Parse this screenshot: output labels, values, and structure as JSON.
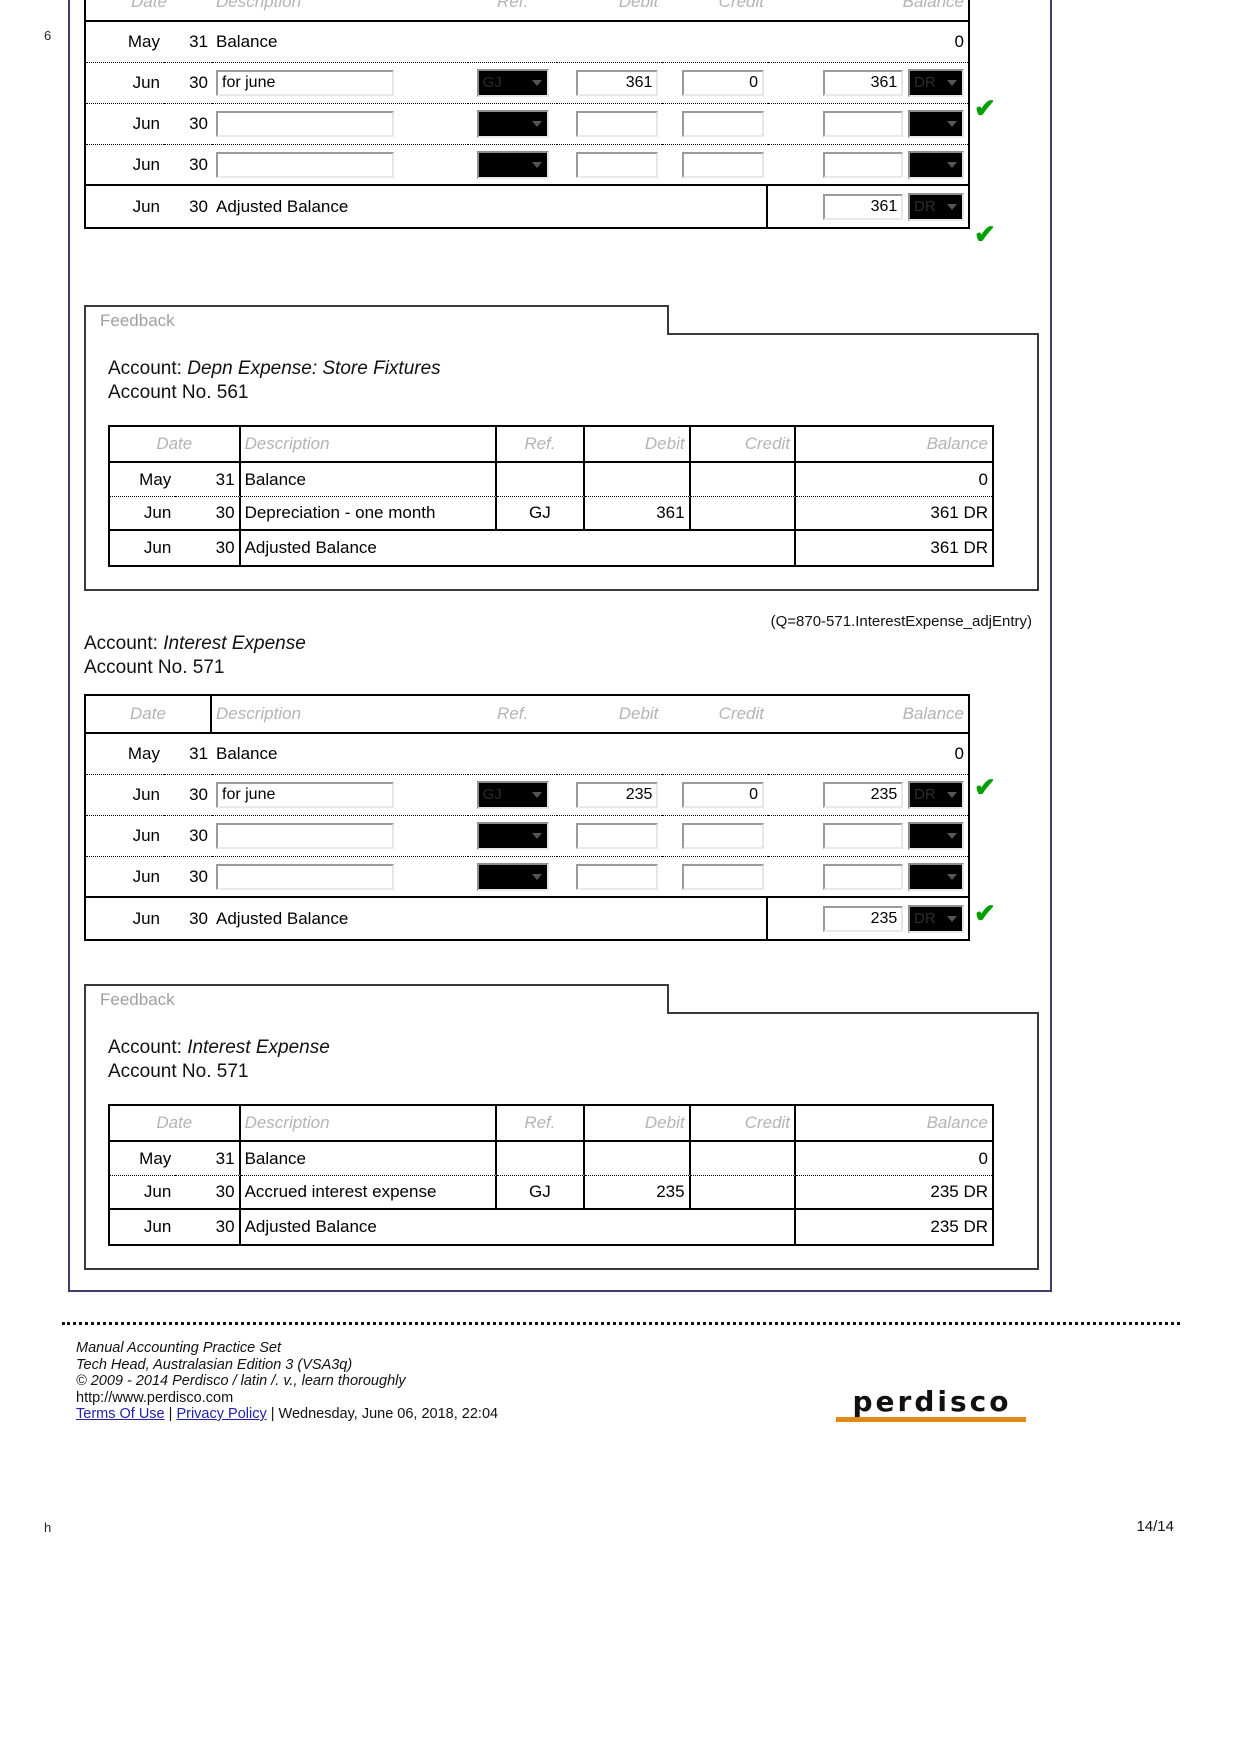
{
  "page": {
    "page_number": "14/14",
    "edge_mark_top": "6",
    "edge_mark_bottom": "h"
  },
  "ledger_columns": {
    "date": "Date",
    "description": "Description",
    "ref": "Ref.",
    "debit": "Debit",
    "credit": "Credit",
    "balance": "Balance"
  },
  "section_depn": {
    "entry_table": {
      "rows": [
        {
          "month": "May",
          "day": "31",
          "desc": "Balance",
          "type": "static",
          "ref": "",
          "debit": "",
          "credit": "",
          "balance": "0",
          "dr": "",
          "tick": false
        },
        {
          "month": "Jun",
          "day": "30",
          "desc": "for june",
          "type": "input",
          "ref": "GJ",
          "debit": "361",
          "credit": "0",
          "balance": "361",
          "dr": "DR",
          "tick": true
        },
        {
          "month": "Jun",
          "day": "30",
          "desc": "",
          "type": "input",
          "ref": "",
          "debit": "",
          "credit": "",
          "balance": "",
          "dr": "",
          "tick": false
        },
        {
          "month": "Jun",
          "day": "30",
          "desc": "",
          "type": "input",
          "ref": "",
          "debit": "",
          "credit": "",
          "balance": "",
          "dr": "",
          "tick": false
        }
      ],
      "adjusted": {
        "month": "Jun",
        "day": "30",
        "label": "Adjusted Balance",
        "balance": "361",
        "dr": "DR",
        "tick": true
      }
    },
    "feedback": {
      "tab_label": "Feedback",
      "account_label": "Account:",
      "account_name": "Depn Expense: Store Fixtures",
      "account_no_label": "Account No.",
      "account_no": "561",
      "rows": [
        {
          "month": "May",
          "day": "31",
          "desc": "Balance",
          "ref": "",
          "debit": "",
          "credit": "",
          "balance": "0"
        },
        {
          "month": "Jun",
          "day": "30",
          "desc": "Depreciation - one month",
          "ref": "GJ",
          "debit": "361",
          "credit": "",
          "balance": "361 DR"
        },
        {
          "month": "Jun",
          "day": "30",
          "desc": "Adjusted Balance",
          "ref": "",
          "debit": "",
          "credit": "",
          "balance": "361 DR"
        }
      ]
    }
  },
  "section_interest": {
    "q_label": "(Q=870-571.InterestExpense_adjEntry)",
    "account_label": "Account:",
    "account_name": "Interest Expense",
    "account_no_label": "Account No.",
    "account_no": "571",
    "entry_table": {
      "rows": [
        {
          "month": "May",
          "day": "31",
          "desc": "Balance",
          "type": "static",
          "ref": "",
          "debit": "",
          "credit": "",
          "balance": "0",
          "dr": "",
          "tick": false
        },
        {
          "month": "Jun",
          "day": "30",
          "desc": "for june",
          "type": "input",
          "ref": "GJ",
          "debit": "235",
          "credit": "0",
          "balance": "235",
          "dr": "DR",
          "tick": true
        },
        {
          "month": "Jun",
          "day": "30",
          "desc": "",
          "type": "input",
          "ref": "",
          "debit": "",
          "credit": "",
          "balance": "",
          "dr": "",
          "tick": false
        },
        {
          "month": "Jun",
          "day": "30",
          "desc": "",
          "type": "input",
          "ref": "",
          "debit": "",
          "credit": "",
          "balance": "",
          "dr": "",
          "tick": false
        }
      ],
      "adjusted": {
        "month": "Jun",
        "day": "30",
        "label": "Adjusted Balance",
        "balance": "235",
        "dr": "DR",
        "tick": true
      }
    },
    "feedback": {
      "tab_label": "Feedback",
      "account_label": "Account:",
      "account_name": "Interest Expense",
      "account_no_label": "Account No.",
      "account_no": "571",
      "rows": [
        {
          "month": "May",
          "day": "31",
          "desc": "Balance",
          "ref": "",
          "debit": "",
          "credit": "",
          "balance": "0"
        },
        {
          "month": "Jun",
          "day": "30",
          "desc": "Accrued interest expense",
          "ref": "GJ",
          "debit": "235",
          "credit": "",
          "balance": "235 DR"
        },
        {
          "month": "Jun",
          "day": "30",
          "desc": "Adjusted Balance",
          "ref": "",
          "debit": "",
          "credit": "",
          "balance": "235 DR"
        }
      ]
    }
  },
  "footer": {
    "line1": "Manual Accounting Practice Set",
    "line2": "Tech Head, Australasian Edition 3 (VSA3q)",
    "line3": "© 2009 - 2014 Perdisco / latin /. v., learn thoroughly",
    "line4": "http://www.perdisco.com",
    "terms": "Terms Of Use",
    "separator": " | ",
    "privacy": "Privacy Policy",
    "timestamp": " | Wednesday, June 06, 2018, 22:04",
    "logo_text": "perdisco"
  },
  "colors": {
    "tick_green": "#00a000",
    "logo_orange": "#e08b17",
    "frame_blue": "#3f3f6b",
    "header_gray": "#b4b4b4"
  }
}
